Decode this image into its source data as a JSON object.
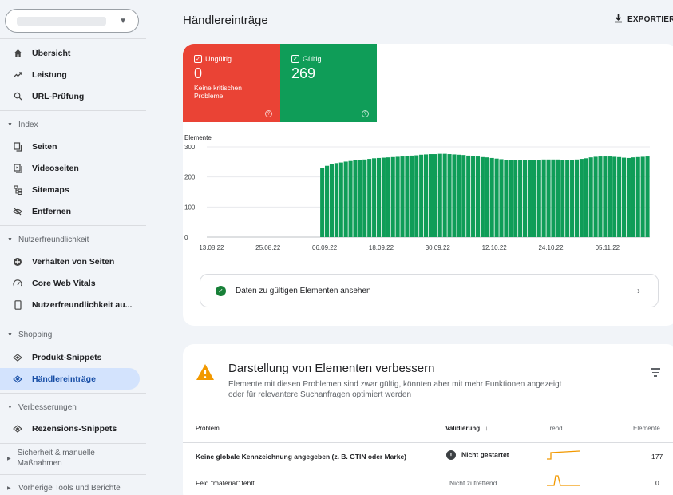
{
  "sidebar": {
    "property_select": {
      "value": ""
    },
    "items_top": [
      {
        "label": "Übersicht",
        "icon": "home-icon"
      },
      {
        "label": "Leistung",
        "icon": "trending-icon"
      },
      {
        "label": "URL-Prüfung",
        "icon": "search-icon"
      }
    ],
    "sections": [
      {
        "title": "Index",
        "items": [
          {
            "label": "Seiten",
            "icon": "pages-icon"
          },
          {
            "label": "Videoseiten",
            "icon": "video-pages-icon"
          },
          {
            "label": "Sitemaps",
            "icon": "sitemap-icon"
          },
          {
            "label": "Entfernen",
            "icon": "removal-icon"
          }
        ]
      },
      {
        "title": "Nutzerfreundlichkeit",
        "items": [
          {
            "label": "Verhalten von Seiten",
            "icon": "page-experience-icon"
          },
          {
            "label": "Core Web Vitals",
            "icon": "speed-gauge-icon"
          },
          {
            "label": "Nutzerfreundlichkeit au...",
            "icon": "mobile-icon"
          }
        ]
      },
      {
        "title": "Shopping",
        "items": [
          {
            "label": "Produkt-Snippets",
            "icon": "diamond-icon"
          },
          {
            "label": "Händlereinträge",
            "icon": "diamond-icon"
          }
        ]
      },
      {
        "title": "Verbesserungen",
        "items": [
          {
            "label": "Rezensions-Snippets",
            "icon": "diamond-icon"
          }
        ]
      }
    ],
    "security_section": "Sicherheit & manuelle Maßnahmen",
    "legacy_section": "Vorherige Tools und Berichte"
  },
  "header": {
    "title": "Händlereinträge",
    "export_label": "EXPORTIER"
  },
  "summary": {
    "invalid": {
      "label": "Ungültig",
      "count": "0",
      "note": "Keine kritischen Probleme",
      "color": "#ea4335"
    },
    "valid": {
      "label": "Gültig",
      "count": "269",
      "color": "#0f9d58"
    }
  },
  "chart_data": {
    "type": "bar",
    "ylabel": "Elemente",
    "ylim": [
      0,
      300
    ],
    "yticks": [
      0,
      100,
      200,
      300
    ],
    "xtick_labels": [
      "13.08.22",
      "25.08.22",
      "06.09.22",
      "18.09.22",
      "30.09.22",
      "12.10.22",
      "24.10.22",
      "05.11.22"
    ],
    "start_date": "2022-08-13",
    "series": [
      {
        "color": "#0f9d58",
        "values": [
          0,
          0,
          0,
          0,
          0,
          0,
          0,
          0,
          0,
          0,
          0,
          0,
          0,
          0,
          0,
          0,
          0,
          0,
          0,
          0,
          0,
          0,
          0,
          0,
          230,
          237,
          243,
          246,
          248,
          251,
          253,
          255,
          257,
          258,
          260,
          262,
          263,
          264,
          265,
          266,
          267,
          268,
          270,
          271,
          272,
          274,
          275,
          276,
          276,
          277,
          277,
          276,
          275,
          274,
          273,
          271,
          269,
          268,
          266,
          265,
          263,
          261,
          259,
          257,
          256,
          255,
          255,
          255,
          256,
          257,
          257,
          258,
          258,
          258,
          258,
          257,
          257,
          257,
          258,
          260,
          262,
          265,
          267,
          268,
          268,
          268,
          267,
          266,
          264,
          263,
          265,
          266,
          267,
          268
        ]
      }
    ]
  },
  "cta": {
    "label": "Daten zu gültigen Elementen ansehen"
  },
  "improve": {
    "title": "Darstellung von Elementen verbessern",
    "description": "Elemente mit diesen Problemen sind zwar gültig, könnten aber mit mehr Funktionen angezeigt oder für relevantere Suchanfragen optimiert werden",
    "columns": {
      "problem": "Problem",
      "validation": "Validierung",
      "trend": "Trend",
      "items": "Elemente"
    },
    "rows": [
      {
        "problem": "Keine globale Kennzeichnung angegeben (z. B. GTIN oder Marke)",
        "validation": "Nicht gestartet",
        "items": "177",
        "trend_color": "#f29900"
      },
      {
        "problem": "Feld \"material\" fehlt",
        "validation": "Nicht zutreffend",
        "items": "0",
        "trend_color": "#f29900"
      }
    ]
  }
}
